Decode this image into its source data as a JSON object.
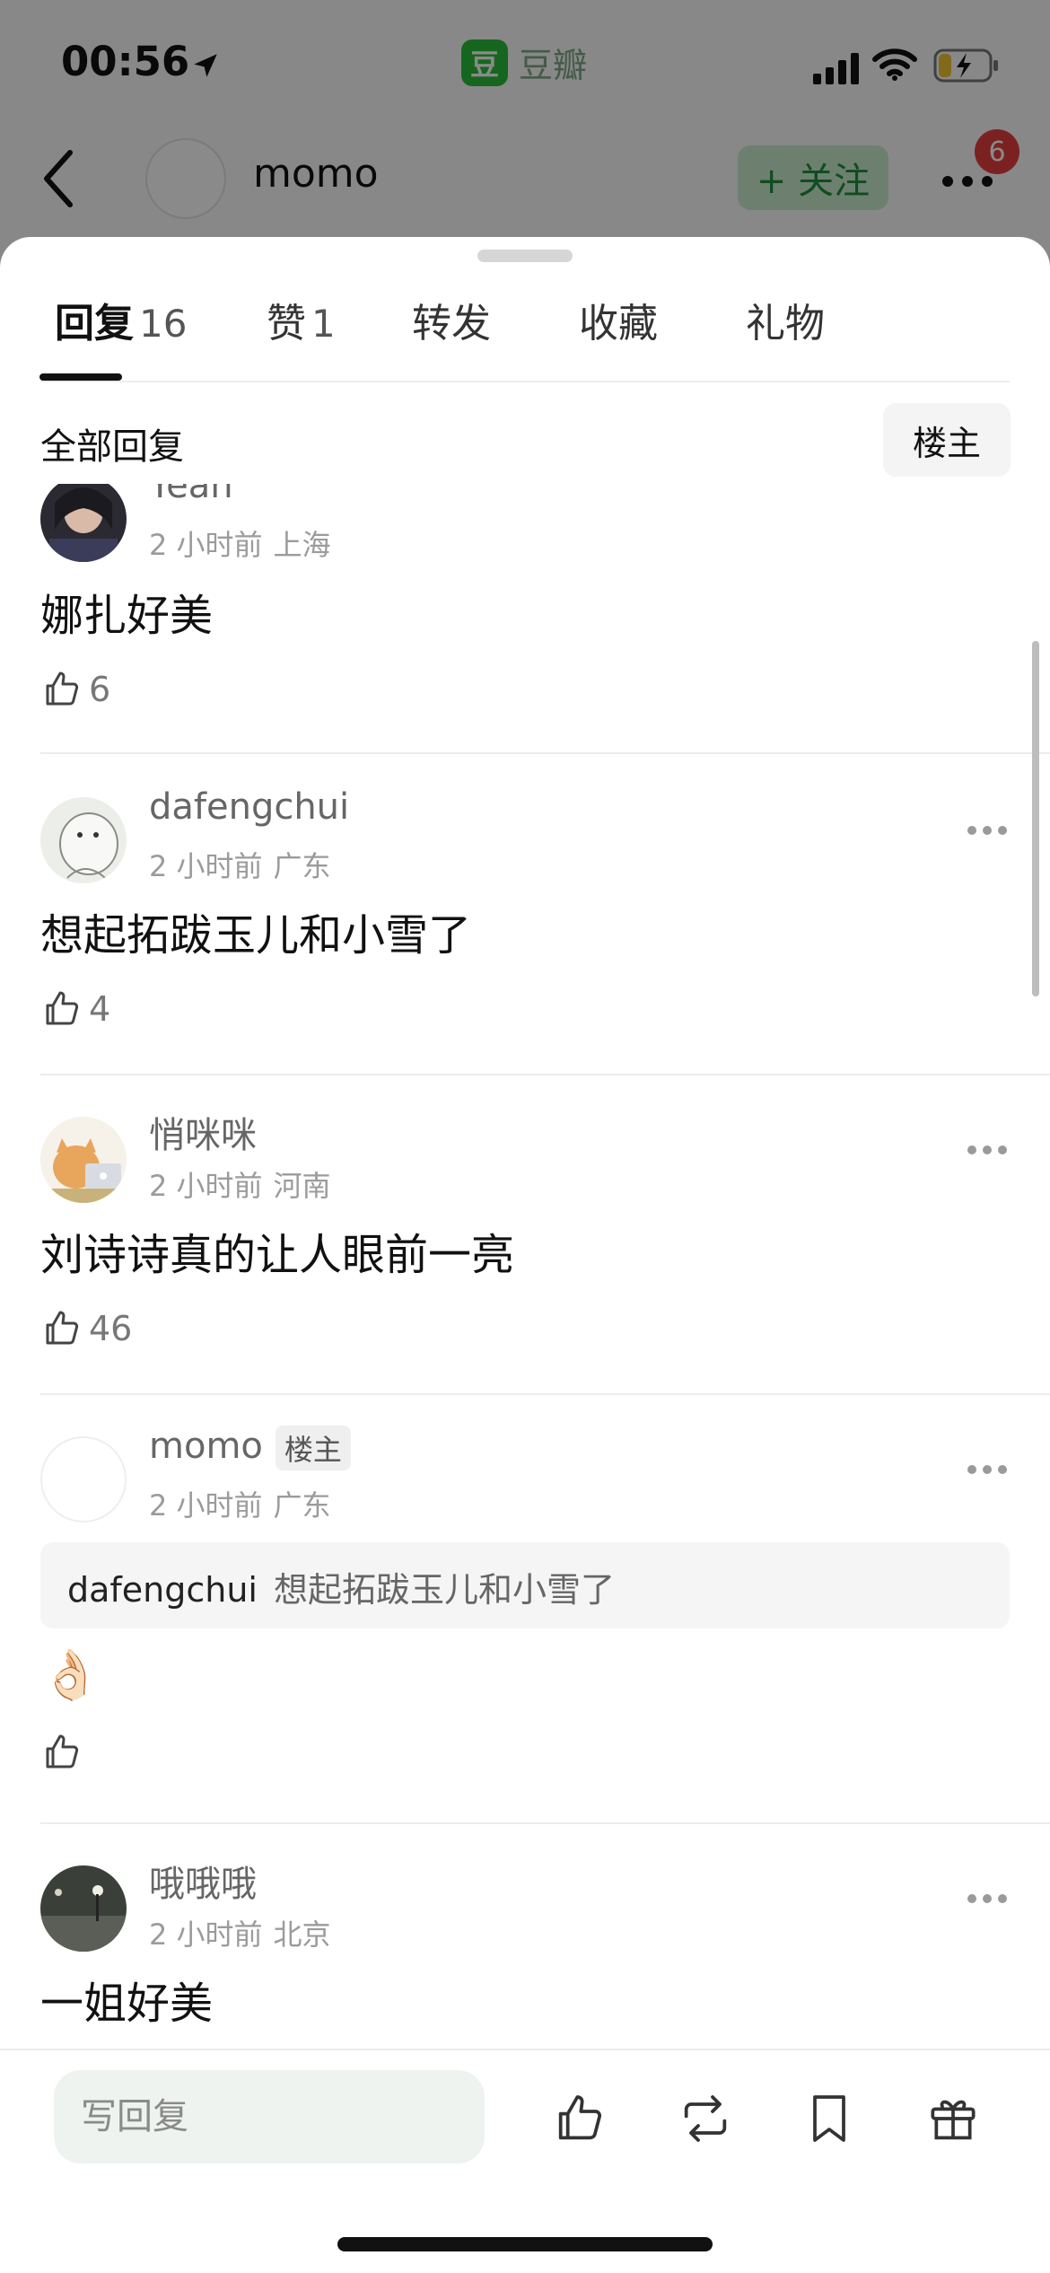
{
  "status_bar": {
    "time": "00:56",
    "app_name": "豆瓣",
    "app_icon_char": "豆"
  },
  "nav": {
    "username": "momo",
    "follow_label": "+ 关注",
    "notification_count": "6"
  },
  "tabs": [
    {
      "label": "回复",
      "count": "16",
      "active": true
    },
    {
      "label": "赞",
      "count": "1",
      "active": false
    },
    {
      "label": "转发",
      "count": "",
      "active": false
    },
    {
      "label": "收藏",
      "count": "",
      "active": false
    },
    {
      "label": "礼物",
      "count": "",
      "active": false
    }
  ],
  "filter": {
    "label": "全部回复",
    "host_button": "楼主"
  },
  "comments": [
    {
      "username": "Yean",
      "time": "2 小时前",
      "location": "上海",
      "text": "娜扎好美",
      "likes": "6"
    },
    {
      "username": "dafengchui",
      "time": "2 小时前",
      "location": "广东",
      "text": "想起拓跋玉儿和小雪了",
      "likes": "4"
    },
    {
      "username": "悄咪咪",
      "time": "2 小时前",
      "location": "河南",
      "text": "刘诗诗真的让人眼前一亮",
      "likes": "46"
    },
    {
      "username": "momo",
      "host_tag": "楼主",
      "time": "2 小时前",
      "location": "广东",
      "quote_user": "dafengchui",
      "quote_text": "想起拓跋玉儿和小雪了",
      "text": "👌🏻",
      "likes": ""
    },
    {
      "username": "哦哦哦",
      "time": "2 小时前",
      "location": "北京",
      "text": "一姐好美",
      "likes": ""
    }
  ],
  "bottom_bar": {
    "reply_placeholder": "写回复"
  },
  "colors": {
    "accent_green": "#2bbd3a",
    "follow_bg": "#c9ecd0",
    "follow_text": "#1e8f3a",
    "badge_red": "#e53d3d"
  }
}
